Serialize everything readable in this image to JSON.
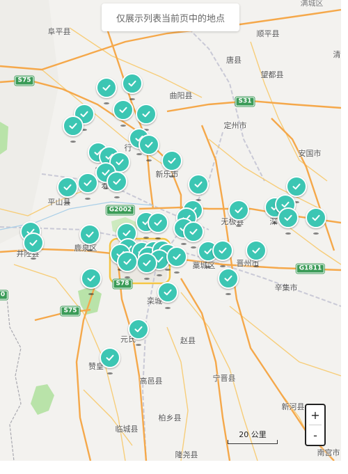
{
  "notice": "仅展示列表当前页中的地点",
  "zoom": {
    "in_label": "+",
    "out_label": "-"
  },
  "scale": {
    "label": "20 公里"
  },
  "colors": {
    "marker": "#3cc6b3",
    "road_major": "#f5a84a",
    "shield": "#3a9b57"
  },
  "places": [
    {
      "name": "满城区",
      "grey": true
    },
    {
      "name": "阜平县",
      "grey": false
    },
    {
      "name": "顺平县",
      "grey": false
    },
    {
      "name": "清",
      "grey": false
    },
    {
      "name": "唐县",
      "grey": false
    },
    {
      "name": "望都县",
      "grey": false
    },
    {
      "name": "曲阳县",
      "grey": false
    },
    {
      "name": "定州市",
      "grey": false
    },
    {
      "name": "安国市",
      "grey": false
    },
    {
      "name": "行",
      "grey": false
    },
    {
      "name": "新乐市",
      "grey": false
    },
    {
      "name": "平山县",
      "grey": false
    },
    {
      "name": "寿",
      "grey": false
    },
    {
      "name": "无极县",
      "grey": false
    },
    {
      "name": "深",
      "grey": false
    },
    {
      "name": "鹿泉区",
      "grey": false
    },
    {
      "name": "井陉县",
      "grey": false
    },
    {
      "name": "藁城区",
      "grey": false
    },
    {
      "name": "晋州市",
      "grey": false
    },
    {
      "name": "辛集市",
      "grey": false
    },
    {
      "name": "栾城",
      "grey": false
    },
    {
      "name": "元氏",
      "grey": false
    },
    {
      "name": "赵县",
      "grey": false
    },
    {
      "name": "赞皇",
      "grey": false
    },
    {
      "name": "高邑县",
      "grey": false
    },
    {
      "name": "宁晋县",
      "grey": false
    },
    {
      "name": "柏乡县",
      "grey": false
    },
    {
      "name": "新河县",
      "grey": false
    },
    {
      "name": "临城县",
      "grey": false
    },
    {
      "name": "隆尧县",
      "grey": false
    },
    {
      "name": "南宫市",
      "grey": false
    }
  ],
  "shields": [
    "S75",
    "S31",
    "G2002",
    "S78",
    "G1811",
    "S75",
    "0"
  ],
  "marker_count": 52
}
